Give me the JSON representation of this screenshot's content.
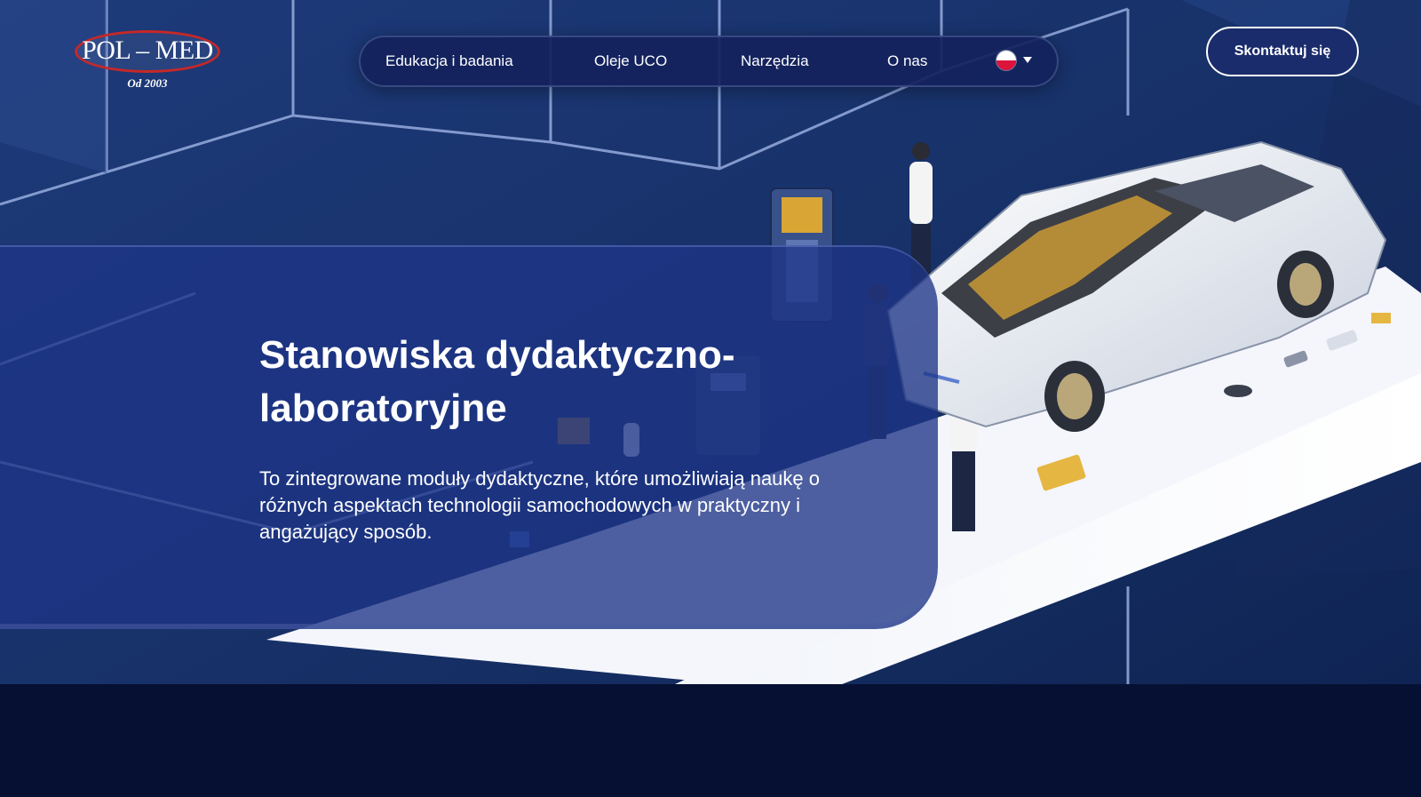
{
  "logo": {
    "name": "POL – MED",
    "since": "Od 2003"
  },
  "nav": {
    "items": [
      {
        "label": "Edukacja i badania"
      },
      {
        "label": "Oleje UCO"
      },
      {
        "label": "Narzędzia"
      },
      {
        "label": "O nas"
      }
    ]
  },
  "cta": {
    "contact_label": "Skontaktuj się"
  },
  "hero": {
    "title": "Stanowiska dydaktyczno-laboratoryjne",
    "description": "To zintegrowane moduły dydaktyczne, które umożliwiają naukę o różnych aspektach technologii samochodowych w praktyczny i angażujący sposób."
  },
  "colors": {
    "background": "#0b1a45",
    "nav_bg": "#14225c",
    "logo_red": "#c62828",
    "footer": "#061033"
  }
}
